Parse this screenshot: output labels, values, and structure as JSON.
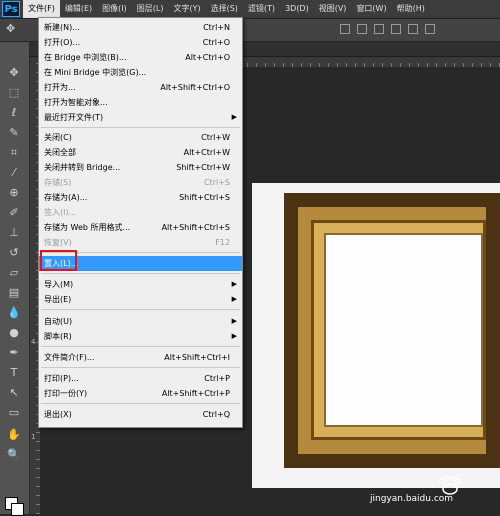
{
  "app_logo": "Ps",
  "menubar": [
    "文件(F)",
    "编辑(E)",
    "图像(I)",
    "图层(L)",
    "文字(Y)",
    "选择(S)",
    "滤镜(T)",
    "3D(D)",
    "视图(V)",
    "窗口(W)",
    "帮助(H)"
  ],
  "ruler_labels": [
    "4",
    "1"
  ],
  "file_menu": [
    {
      "label": "新建(N)...",
      "shortcut": "Ctrl+N"
    },
    {
      "label": "打开(O)...",
      "shortcut": "Ctrl+O"
    },
    {
      "label": "在 Bridge 中浏览(B)...",
      "shortcut": "Alt+Ctrl+O"
    },
    {
      "label": "在 Mini Bridge 中浏览(G)...",
      "shortcut": ""
    },
    {
      "label": "打开为...",
      "shortcut": "Alt+Shift+Ctrl+O"
    },
    {
      "label": "打开为智能对象...",
      "shortcut": ""
    },
    {
      "label": "最近打开文件(T)",
      "shortcut": "",
      "submenu": true
    },
    {
      "label": "关闭(C)",
      "shortcut": "Ctrl+W"
    },
    {
      "label": "关闭全部",
      "shortcut": "Alt+Ctrl+W"
    },
    {
      "label": "关闭并转到 Bridge...",
      "shortcut": "Shift+Ctrl+W"
    },
    {
      "label": "存储(S)",
      "shortcut": "Ctrl+S",
      "disabled": true
    },
    {
      "label": "存储为(A)...",
      "shortcut": "Shift+Ctrl+S"
    },
    {
      "label": "签入(I)...",
      "shortcut": "",
      "disabled": true
    },
    {
      "label": "存储为 Web 所用格式...",
      "shortcut": "Alt+Shift+Ctrl+S"
    },
    {
      "label": "恢复(V)",
      "shortcut": "F12",
      "disabled": true
    },
    {
      "label": "置入(L)...",
      "shortcut": "",
      "selected": true
    },
    {
      "label": "导入(M)",
      "shortcut": "",
      "submenu": true
    },
    {
      "label": "导出(E)",
      "shortcut": "",
      "submenu": true
    },
    {
      "label": "自动(U)",
      "shortcut": "",
      "submenu": true
    },
    {
      "label": "脚本(R)",
      "shortcut": "",
      "submenu": true
    },
    {
      "label": "文件简介(F)...",
      "shortcut": "Alt+Shift+Ctrl+I"
    },
    {
      "label": "打印(P)...",
      "shortcut": "Ctrl+P"
    },
    {
      "label": "打印一份(Y)",
      "shortcut": "Alt+Shift+Ctrl+P"
    },
    {
      "label": "退出(X)",
      "shortcut": "Ctrl+Q"
    }
  ],
  "watermark": "jingyan.baidu.com",
  "colors": {
    "selection": "#3399ff",
    "highlight_box": "#e0141e",
    "frame_gold": "#b58a3c"
  },
  "tool_icons": [
    "move-icon",
    "marquee-icon",
    "lasso-icon",
    "quick-select-icon",
    "crop-icon",
    "eyedropper-icon",
    "healing-brush-icon",
    "brush-icon",
    "clone-stamp-icon",
    "history-brush-icon",
    "eraser-icon",
    "gradient-icon",
    "blur-icon",
    "dodge-icon",
    "pen-icon",
    "type-icon",
    "path-select-icon",
    "shape-icon",
    "hand-icon",
    "zoom-icon"
  ]
}
